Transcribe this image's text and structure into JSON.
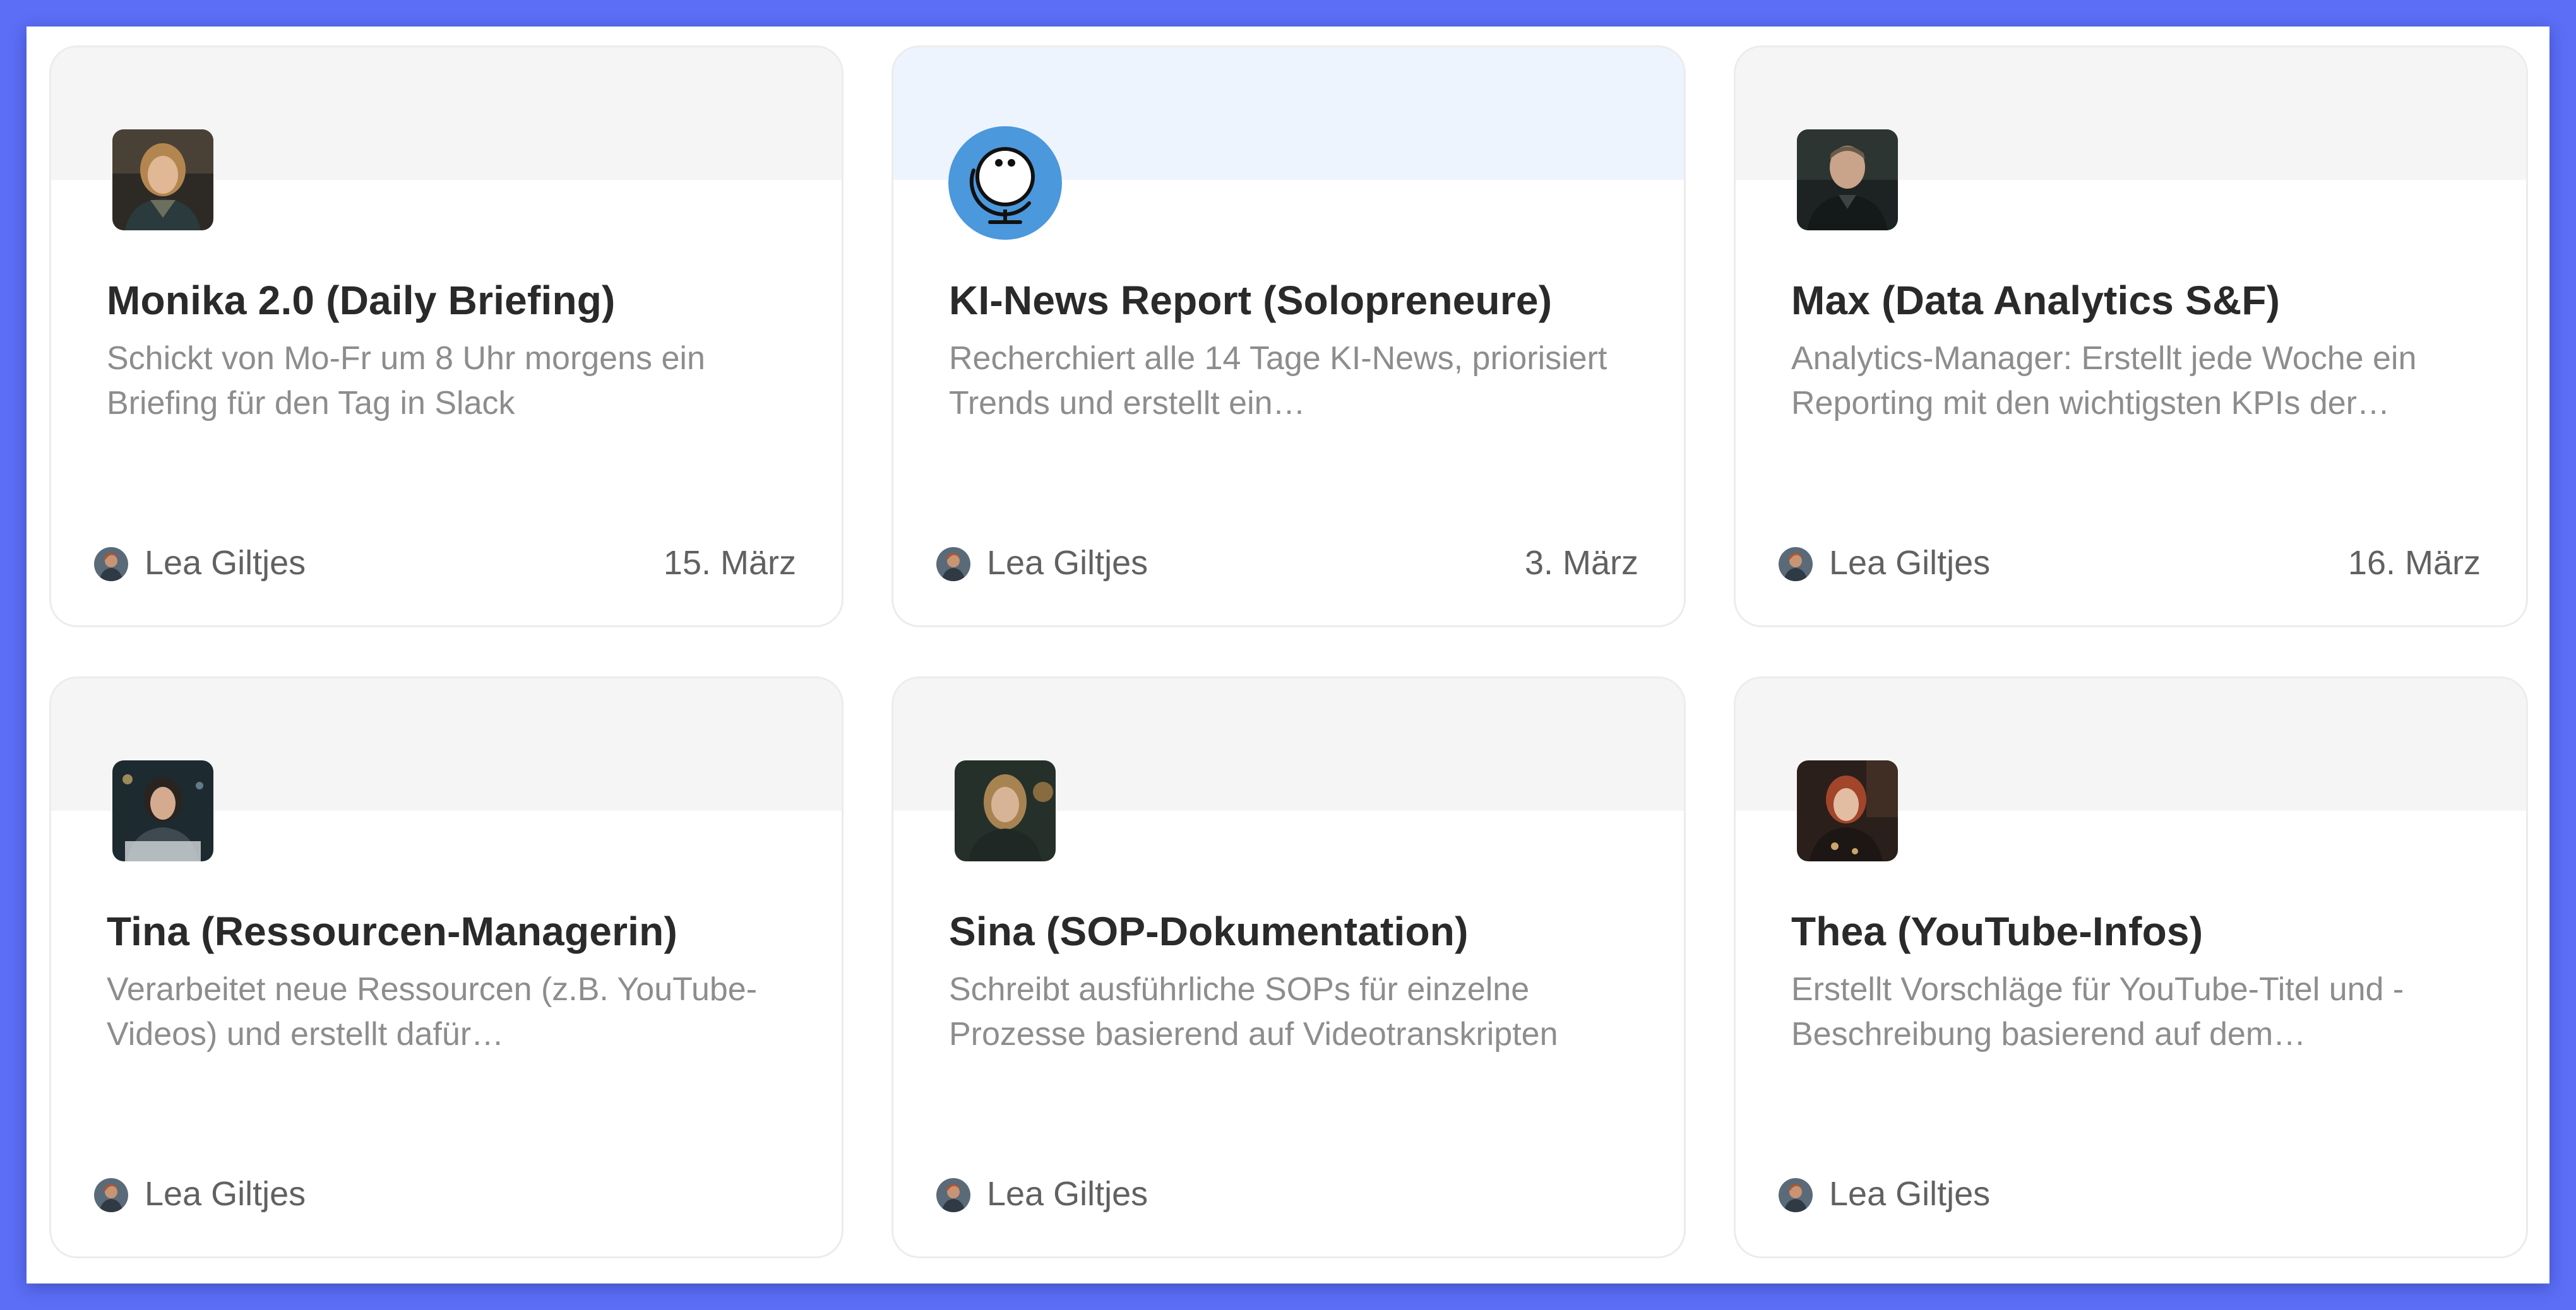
{
  "cards": [
    {
      "title": "Monika 2.0 (Daily Briefing)",
      "description": "Schickt von Mo-Fr um 8 Uhr morgens ein Briefing für den Tag in Slack",
      "author": "Lea Giltjes",
      "date": "15. März",
      "avatar": "portrait-photo"
    },
    {
      "title": "KI-News Report (Solopreneure)",
      "description": "Recherchiert alle 14 Tage KI-News, priorisiert Trends und erstellt ein…",
      "author": "Lea Giltjes",
      "date": "3. März",
      "avatar": "globe-icon"
    },
    {
      "title": "Max (Data Analytics S&F)",
      "description": "Analytics-Manager: Erstellt jede Woche ein Reporting mit den wichtigsten KPIs der…",
      "author": "Lea Giltjes",
      "date": "16. März",
      "avatar": "portrait-photo"
    },
    {
      "title": "Tina (Ressourcen-Managerin)",
      "description": "Verarbeitet neue Ressourcen (z.B. YouTube-Videos) und erstellt dafür…",
      "author": "Lea Giltjes",
      "date": "",
      "avatar": "portrait-photo"
    },
    {
      "title": "Sina (SOP-Dokumentation)",
      "description": "Schreibt ausführliche SOPs für einzelne Prozesse basierend auf Videotranskripten",
      "author": "Lea Giltjes",
      "date": "",
      "avatar": "portrait-photo"
    },
    {
      "title": "Thea (YouTube-Infos)",
      "description": "Erstellt Vorschläge für YouTube-Titel und -Beschreibung basierend auf dem…",
      "author": "Lea Giltjes",
      "date": "",
      "avatar": "portrait-photo"
    }
  ],
  "colors": {
    "background": "#5b6ef5",
    "card_banner": "#f5f5f5",
    "card_banner_highlight": "#eef4fd",
    "globe_avatar": "#4b98dd",
    "title": "#2a2a2a",
    "description": "#8d8d8d",
    "meta": "#616161"
  }
}
